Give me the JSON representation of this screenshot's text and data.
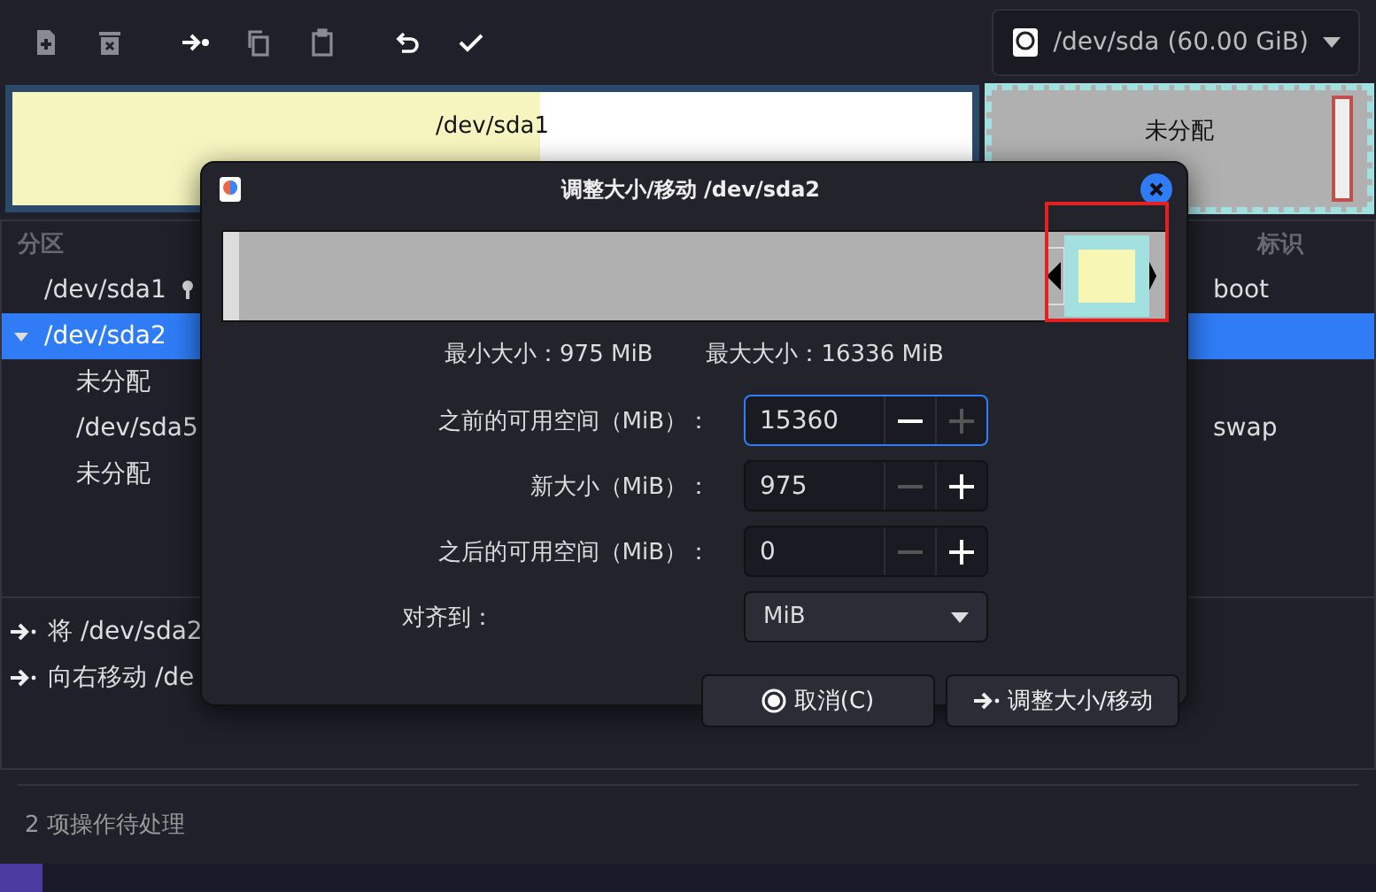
{
  "toolbar": [
    {
      "kind": "new",
      "disabled": true
    },
    {
      "kind": "delete",
      "disabled": true
    },
    {
      "kind": "resize",
      "disabled": false
    },
    {
      "kind": "copy",
      "disabled": true
    },
    {
      "kind": "paste",
      "disabled": true
    },
    {
      "kind": "undo",
      "disabled": false
    },
    {
      "kind": "apply",
      "disabled": false
    }
  ],
  "device_selector": {
    "label": "/dev/sda (60.00 GiB)"
  },
  "disk_map": {
    "partition": {
      "name": "/dev/sda1",
      "level": 0.55
    },
    "extended": {
      "name": "未分配"
    }
  },
  "partition_table": {
    "columns": [
      "分区",
      "标识"
    ],
    "rows": [
      {
        "name": "/dev/sda1",
        "flags": "boot",
        "locked": true,
        "selected": false
      },
      {
        "name": "/dev/sda2",
        "selected": true,
        "expanded": true,
        "children": [
          {
            "name": "未分配"
          },
          {
            "name": "/dev/sda5",
            "flags": "swap"
          },
          {
            "name": "未分配"
          }
        ]
      }
    ]
  },
  "operations": [
    "将 /dev/sda2",
    "向右移动 /de"
  ],
  "status_bar": "2 项操作待处理",
  "dialog": {
    "title": "调整大小/移动 /dev/sda2",
    "min_size": "最小大小：975 MiB",
    "max_size": "最大大小：16336 MiB",
    "fields": [
      {
        "label": "之前的可用空间（MiB）：",
        "value": "15360",
        "focused": true,
        "minus_disabled": false,
        "plus_disabled": true
      },
      {
        "label": "新大小（MiB）：",
        "value": "975",
        "focused": false,
        "minus_disabled": true,
        "plus_disabled": false
      },
      {
        "label": "之后的可用空间（MiB）：",
        "value": "0",
        "focused": false,
        "minus_disabled": true,
        "plus_disabled": false
      }
    ],
    "align": {
      "label": "对齐到：",
      "value": "MiB"
    },
    "buttons": [
      {
        "kind": "cancel",
        "label": "取消(C)"
      },
      {
        "kind": "apply",
        "label": "调整大小/移动"
      }
    ]
  }
}
